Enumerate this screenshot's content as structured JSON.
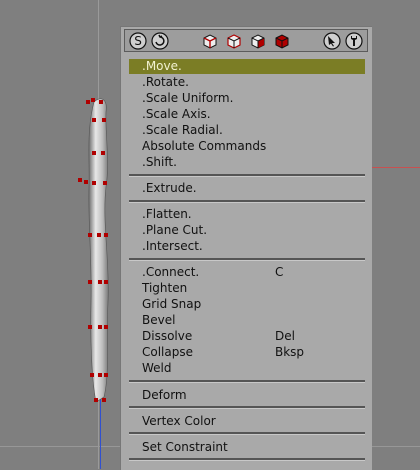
{
  "toolbar": {
    "undo_icon": "undo-icon",
    "redo_icon": "redo-icon",
    "view_icons": [
      "cube-front-icon",
      "cube-side-icon",
      "cube-top-icon",
      "cube-solid-icon"
    ],
    "select_icon": "arrow-cursor-icon",
    "tools_icon": "wrench-icon"
  },
  "menu": {
    "group1": [
      {
        "label": ".Move.",
        "shortcut": "",
        "selected": true
      },
      {
        "label": ".Rotate.",
        "shortcut": ""
      },
      {
        "label": ".Scale Uniform.",
        "shortcut": ""
      },
      {
        "label": ".Scale Axis.",
        "shortcut": ""
      },
      {
        "label": ".Scale Radial.",
        "shortcut": ""
      },
      {
        "label": "Absolute Commands",
        "shortcut": ""
      },
      {
        "label": ".Shift.",
        "shortcut": ""
      }
    ],
    "group2": [
      {
        "label": ".Extrude.",
        "shortcut": ""
      }
    ],
    "group3": [
      {
        "label": ".Flatten.",
        "shortcut": ""
      },
      {
        "label": ".Plane Cut.",
        "shortcut": ""
      },
      {
        "label": ".Intersect.",
        "shortcut": ""
      }
    ],
    "group4": [
      {
        "label": ".Connect.",
        "shortcut": "C"
      },
      {
        "label": "Tighten",
        "shortcut": ""
      },
      {
        "label": "Grid Snap",
        "shortcut": ""
      },
      {
        "label": "Bevel",
        "shortcut": ""
      },
      {
        "label": "Dissolve",
        "shortcut": "Del"
      },
      {
        "label": "Collapse",
        "shortcut": "Bksp"
      },
      {
        "label": "Weld",
        "shortcut": ""
      }
    ],
    "group5": [
      {
        "label": "Deform",
        "shortcut": ""
      }
    ],
    "group6": [
      {
        "label": "Vertex Color",
        "shortcut": ""
      }
    ],
    "group7": [
      {
        "label": "Set Constraint",
        "shortcut": ""
      }
    ]
  },
  "colors": {
    "selected_bg": "#7b7d25",
    "menu_bg": "#a9a9a9",
    "vertex_red": "#b00000"
  }
}
